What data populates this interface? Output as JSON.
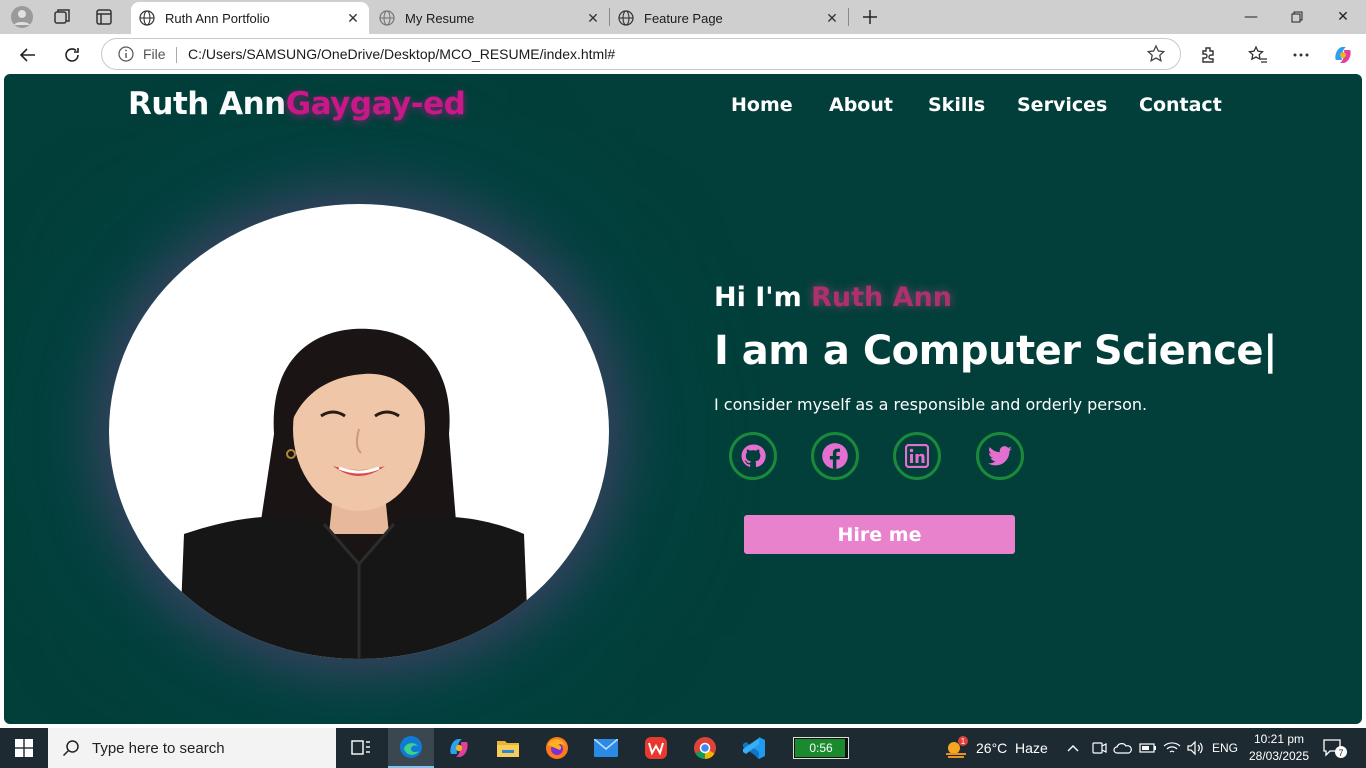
{
  "browser": {
    "tabs": [
      {
        "title": "Ruth Ann Portfolio",
        "active": true
      },
      {
        "title": "My Resume",
        "active": false
      },
      {
        "title": "Feature Page",
        "active": false
      }
    ],
    "address": {
      "scheme_label": "File",
      "url": "C:/Users/SAMSUNG/OneDrive/Desktop/MCO_RESUME/index.html#"
    }
  },
  "site": {
    "logo_first": "Ruth Ann",
    "logo_last": "Gaygay-ed",
    "nav": [
      "Home",
      "About",
      "Skills",
      "Services",
      "Contact"
    ],
    "hero": {
      "greeting": "Hi I'm ",
      "name": "Ruth Ann",
      "role": "I am a Computer Science|",
      "tagline": "I consider myself as a responsible and orderly person.",
      "social_icons": [
        "github-icon",
        "facebook-icon",
        "linkedin-icon",
        "twitter-icon"
      ],
      "cta": "Hire me"
    },
    "colors": {
      "background": "#023f3a",
      "accent": "#d4168c",
      "name_accent": "#b0306e",
      "button": "#e982cc",
      "social_ring": "#1a8a3a",
      "social_icon": "#e56fd0"
    }
  },
  "taskbar": {
    "search_placeholder": "Type here to search",
    "battery": "0:56",
    "weather_badge": "1",
    "weather": "26°C  Haze",
    "lang": "ENG",
    "time": "10:21 pm",
    "date": "28/03/2025",
    "notifications": "7"
  }
}
